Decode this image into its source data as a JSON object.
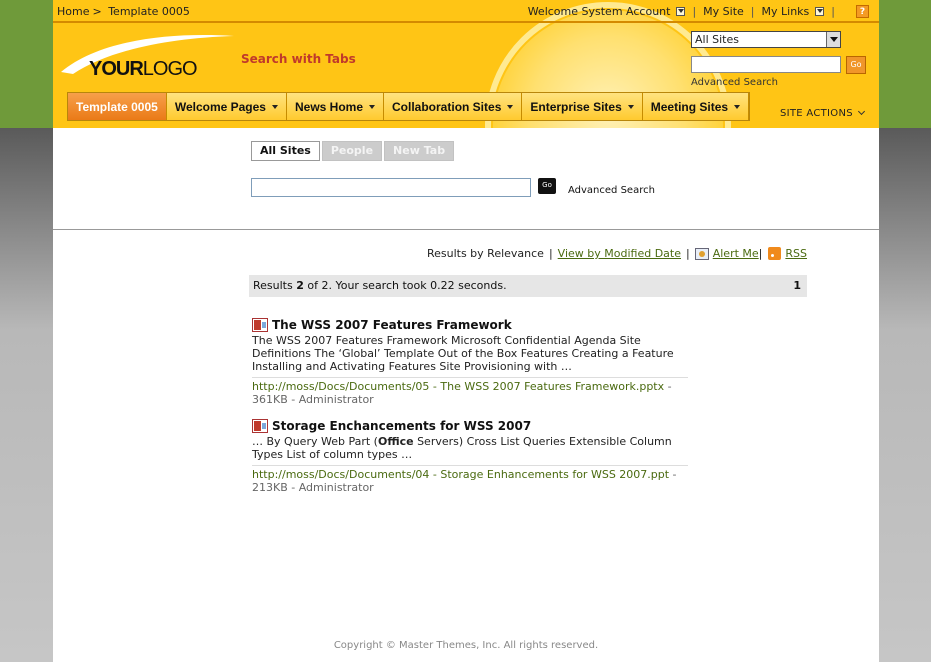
{
  "breadcrumb": {
    "home": "Home",
    "sep": ">",
    "current": "Template 0005"
  },
  "toplinks": {
    "welcome": "Welcome System Account",
    "my_site": "My Site",
    "my_links": "My Links",
    "help": "?"
  },
  "logo": {
    "bold": "YOUR",
    "light": "LOGO"
  },
  "site_title": "Search with Tabs",
  "header_search": {
    "scope": "All Sites",
    "go": "Go",
    "advanced": "Advanced Search"
  },
  "nav": {
    "tabs": [
      {
        "label": "Template 0005"
      },
      {
        "label": "Welcome Pages"
      },
      {
        "label": "News Home"
      },
      {
        "label": "Collaboration Sites"
      },
      {
        "label": "Enterprise Sites"
      },
      {
        "label": "Meeting Sites"
      }
    ],
    "site_actions": "SITE ACTIONS"
  },
  "search_tabs": [
    {
      "label": "All Sites"
    },
    {
      "label": "People"
    },
    {
      "label": "New Tab"
    }
  ],
  "search": {
    "go": "Go",
    "advanced": "Advanced Search"
  },
  "results_bar": {
    "relevance": "Results by Relevance",
    "modified": "View by Modified Date",
    "alert": "Alert Me",
    "rss": "RSS"
  },
  "status": {
    "prefix": "Results ",
    "count": "2",
    "suffix": " of 2. Your search took 0.22 seconds.",
    "page": "1"
  },
  "results": [
    {
      "title": "The WSS 2007 Features Framework",
      "desc": "The WSS 2007 Features Framework Microsoft Confidential Agenda Site Definitions The ‘Global’ Template Out of the Box Features Creating a Feature Installing and Activating Features Site Provisioning with …",
      "url": "http://moss/Docs/Documents/05 - The WSS 2007 Features Framework.pptx",
      "meta": " - 361KB - Administrator"
    },
    {
      "title": "Storage Enchancements for WSS 2007",
      "desc_pre": "… By Query Web Part (",
      "desc_bold": "Office",
      "desc_post": " Servers) Cross List Queries Extensible Column Types List of column types …",
      "url": "http://moss/Docs/Documents/04 - Storage Enhancements for WSS 2007.ppt",
      "meta": " - 213KB - Administrator"
    }
  ],
  "footer": "Copyright © Master Themes, Inc. All rights reserved.",
  "colors": {
    "header": "#ffc515",
    "active_tab": "#ea7a17",
    "link": "#4a6a10",
    "side": "#6f9a3a"
  }
}
